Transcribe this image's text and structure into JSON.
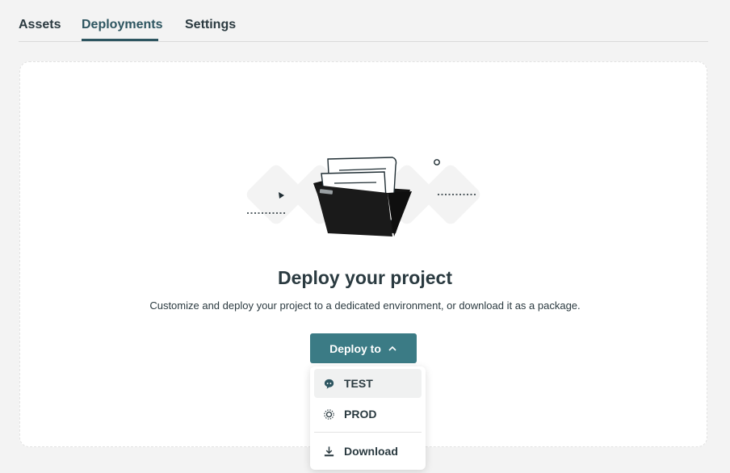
{
  "tabs": [
    {
      "label": "Assets",
      "active": false
    },
    {
      "label": "Deployments",
      "active": true
    },
    {
      "label": "Settings",
      "active": false
    }
  ],
  "empty_state": {
    "title": "Deploy your project",
    "subtitle": "Customize and deploy your project to a dedicated environment, or download it as a package."
  },
  "deploy_button": {
    "label": "Deploy to",
    "icon": "chevron-up-icon"
  },
  "deploy_menu": {
    "items": [
      {
        "label": "TEST",
        "icon": "chat-bubble-icon"
      },
      {
        "label": "PROD",
        "icon": "gear-sun-icon"
      },
      {
        "label": "Download",
        "icon": "download-icon"
      }
    ]
  },
  "colors": {
    "accent": "#3b7b85",
    "tab_active": "#2d5560",
    "background": "#f3f3f3"
  }
}
